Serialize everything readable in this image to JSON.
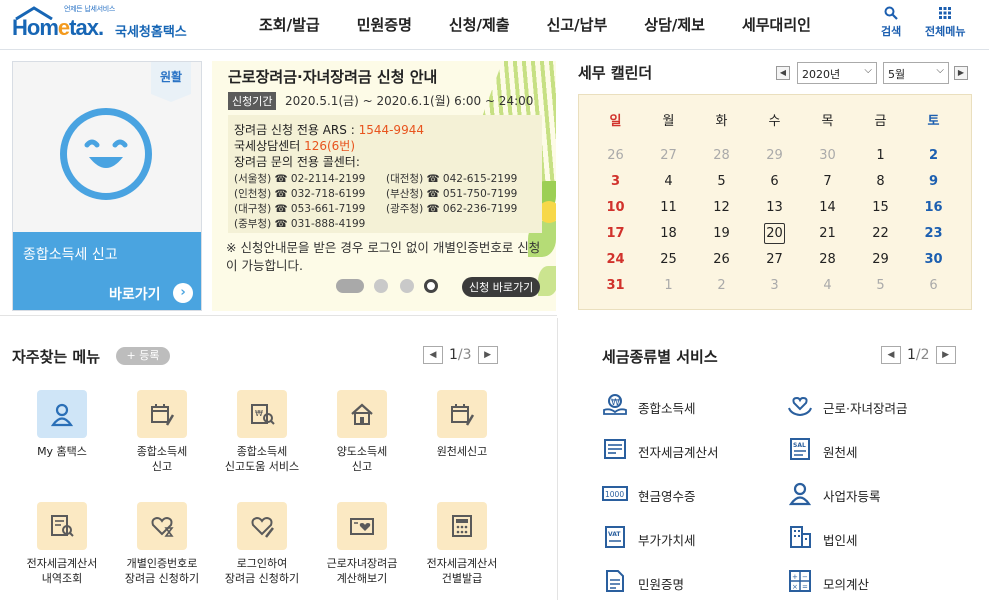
{
  "header": {
    "logo_tagline": "언제든 납세서비스",
    "logo_main_a": "Hom",
    "logo_main_e": "e",
    "logo_main_b": "tax.",
    "logo_sub": "국세청홈택스",
    "nav": [
      "조회/발급",
      "민원증명",
      "신청/제출",
      "신고/납부",
      "상담/제보",
      "세무대리인"
    ],
    "search_label": "검색",
    "allmenu_label": "전체메뉴"
  },
  "left_card": {
    "badge": "원활",
    "title": "종합소득세 신고",
    "go_label": "바로가기"
  },
  "banner": {
    "title": "근로장려금·자녀장려금 신청 안내",
    "period_label": "신청기간",
    "period": "2020.5.1(금) ~ 2020.6.1(월) 6:00 ~ 24:00",
    "ars_label": "장려금 신청 전용 ARS : ",
    "ars_value": "1544-9944",
    "nts_label": "국세상담센터 ",
    "nts_value": "126(6번)",
    "callcenter_label": "장려금 문의 전용 콜센터:",
    "phones": [
      "(서울청) ☎ 02-2114-2199",
      "(대전청) ☎ 042-615-2199",
      "(인천청) ☎ 032-718-6199",
      "(부산청) ☎ 051-750-7199",
      "(대구청) ☎ 053-661-7199",
      "(광주청) ☎ 062-236-7199",
      "(중부청) ☎ 031-888-4199"
    ],
    "note": "※ 신청안내문을 받은 경우 로그인 없이 개별인증번호로 신청이 가능합니다.",
    "apply_label": "신청 바로가기"
  },
  "calendar": {
    "title": "세무 캘린더",
    "year": "2020년",
    "month": "5월",
    "weekdays": [
      "일",
      "월",
      "화",
      "수",
      "목",
      "금",
      "토"
    ],
    "weeks": [
      [
        "26",
        "27",
        "28",
        "29",
        "30",
        "1",
        "2"
      ],
      [
        "3",
        "4",
        "5",
        "6",
        "7",
        "8",
        "9"
      ],
      [
        "10",
        "11",
        "12",
        "13",
        "14",
        "15",
        "16"
      ],
      [
        "17",
        "18",
        "19",
        "20",
        "21",
        "22",
        "23"
      ],
      [
        "24",
        "25",
        "26",
        "27",
        "28",
        "29",
        "30"
      ],
      [
        "31",
        "1",
        "2",
        "3",
        "4",
        "5",
        "6"
      ]
    ],
    "dim_cells": [
      "0-0",
      "0-1",
      "0-2",
      "0-3",
      "0-4",
      "5-1",
      "5-2",
      "5-3",
      "5-4",
      "5-5",
      "5-6"
    ],
    "today": "3-3"
  },
  "frequent": {
    "title": "자주찾는 메뉴",
    "register_label": "+ 등록",
    "page_current": "1",
    "page_total": "/3",
    "items": [
      {
        "label": "My 홈택스",
        "icon": "person-icon"
      },
      {
        "label": "종합소득세\n신고",
        "icon": "calendar-pen-icon"
      },
      {
        "label": "종합소득세\n신고도움 서비스",
        "icon": "won-doc-search-icon"
      },
      {
        "label": "양도소득세\n신고",
        "icon": "house-icon"
      },
      {
        "label": "원천세신고",
        "icon": "calendar-pen-icon"
      },
      {
        "label": "전자세금계산서\n내역조회",
        "icon": "doc-search-icon"
      },
      {
        "label": "개별인증번호로\n장려금 신청하기",
        "icon": "heart-hourglass-icon"
      },
      {
        "label": "로그인하여\n장려금 신청하기",
        "icon": "heart-pen-icon"
      },
      {
        "label": "근로자녀장려금\n계산해보기",
        "icon": "card-heart-icon"
      },
      {
        "label": "전자세금계산서\n건별발급",
        "icon": "calculator-doc-icon"
      }
    ]
  },
  "tax_services": {
    "title": "세금종류별 서비스",
    "page_current": "1",
    "page_total": "/2",
    "items": [
      {
        "label": "종합소득세",
        "icon": "won-hand-icon"
      },
      {
        "label": "근로·자녀장려금",
        "icon": "heart-hands-icon"
      },
      {
        "label": "전자세금계산서",
        "icon": "invoice-icon"
      },
      {
        "label": "원천세",
        "icon": "sal-doc-icon"
      },
      {
        "label": "현금영수증",
        "icon": "receipt-1000-icon"
      },
      {
        "label": "사업자등록",
        "icon": "person-icon"
      },
      {
        "label": "부가가치세",
        "icon": "vat-doc-icon"
      },
      {
        "label": "법인세",
        "icon": "building-icon"
      },
      {
        "label": "민원증명",
        "icon": "document-icon"
      },
      {
        "label": "모의계산",
        "icon": "calculator-icon"
      }
    ]
  },
  "colors": {
    "brand": "#1766b5",
    "accent_orange": "#f39a1e",
    "card_blue": "#4aa4e0",
    "sunday": "#d1322c",
    "saturday": "#1c5fb0"
  }
}
